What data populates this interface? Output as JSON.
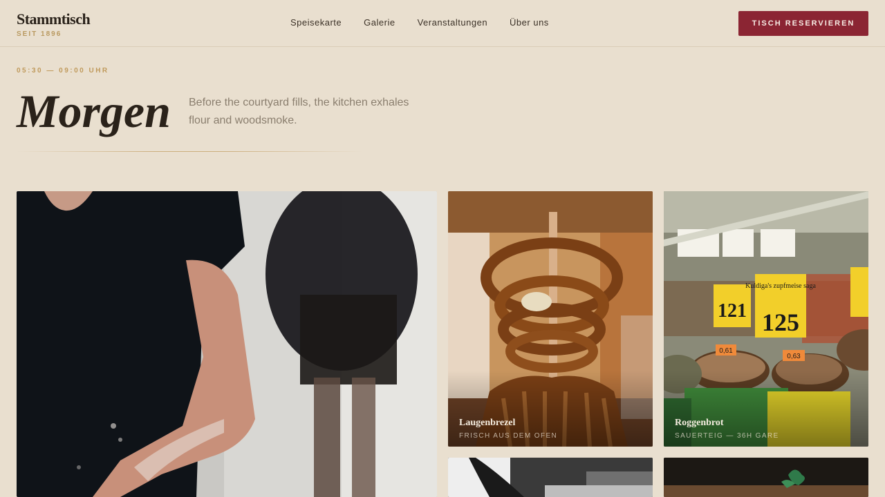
{
  "header": {
    "brand_name": "Stammtisch",
    "brand_since": "SEIT 1896",
    "nav": [
      "Speisekarte",
      "Galerie",
      "Veranstaltungen",
      "Über uns"
    ],
    "reserve_label": "TISCH RESERVIEREN"
  },
  "section": {
    "time": "05:30 — 09:00 UHR",
    "title": "Morgen",
    "description": "Before the courtyard fills, the kitchen exhales flour and woodsmoke."
  },
  "gallery": {
    "brezel": {
      "title": "Laugenbrezel",
      "subtitle": "FRISCH AUS DEM OFEN"
    },
    "brot": {
      "title": "Roggenbrot",
      "subtitle": "SAUERTEIG — 36H GARE"
    },
    "price_tags": [
      "Kuldiga's zupfmeise saga",
      "121",
      "125",
      "0,61",
      "0,63"
    ]
  },
  "colors": {
    "background": "#e9dfcf",
    "accent": "#8b2533",
    "gold": "#c09a5c",
    "text": "#2a221a"
  }
}
